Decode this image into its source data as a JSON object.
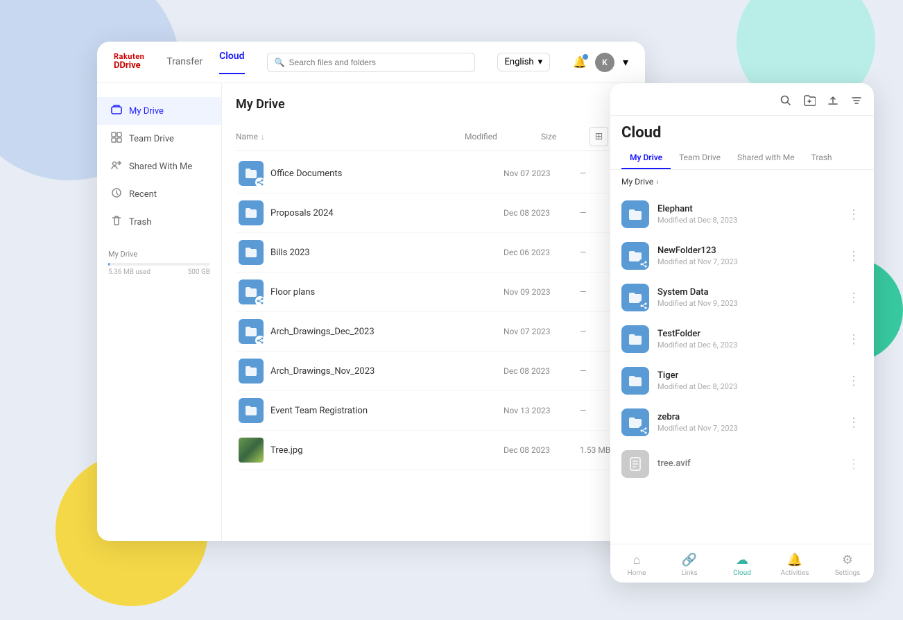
{
  "background": {
    "circles": [
      "blue",
      "teal",
      "yellow",
      "green"
    ]
  },
  "header": {
    "logo_rakuten": "Rakuten",
    "logo_drive": "Drive",
    "nav_transfer": "Transfer",
    "nav_cloud": "Cloud",
    "search_placeholder": "Search files and folders",
    "language": "English",
    "avatar_letter": "K",
    "active_tab": "Cloud"
  },
  "sidebar": {
    "items": [
      {
        "id": "my-drive",
        "label": "My Drive",
        "icon": "🖥",
        "active": true
      },
      {
        "id": "team-drive",
        "label": "Team Drive",
        "icon": "⊞"
      },
      {
        "id": "shared-with-me",
        "label": "Shared With Me",
        "icon": "↗"
      },
      {
        "id": "recent",
        "label": "Recent",
        "icon": "🕐"
      },
      {
        "id": "trash",
        "label": "Trash",
        "icon": "🗑"
      }
    ],
    "storage_label": "My Drive",
    "storage_used": "5.36 MB used",
    "storage_total": "500 GB"
  },
  "file_area": {
    "title": "My Drive",
    "columns": {
      "name": "Name",
      "modified": "Modified",
      "size": "Size"
    },
    "files": [
      {
        "name": "Office Documents",
        "modified": "Nov 07 2023",
        "size": "—",
        "type": "folder-shared"
      },
      {
        "name": "Proposals 2024",
        "modified": "Dec 08 2023",
        "size": "—",
        "type": "folder"
      },
      {
        "name": "Bills 2023",
        "modified": "Dec 06 2023",
        "size": "—",
        "type": "folder"
      },
      {
        "name": "Floor plans",
        "modified": "Nov 09 2023",
        "size": "—",
        "type": "folder-shared"
      },
      {
        "name": "Arch_Drawings_Dec_2023",
        "modified": "Nov 07 2023",
        "size": "—",
        "type": "folder-shared"
      },
      {
        "name": "Arch_Drawings_Nov_2023",
        "modified": "Dec 08 2023",
        "size": "—",
        "type": "folder"
      },
      {
        "name": "Event Team Registration",
        "modified": "Nov 13 2023",
        "size": "—",
        "type": "folder"
      },
      {
        "name": "Tree.jpg",
        "modified": "Dec 08 2023",
        "size": "1.53 MB",
        "type": "image"
      }
    ]
  },
  "right_panel": {
    "title": "Cloud",
    "tabs": [
      "My Drive",
      "Team Drive",
      "Shared with Me",
      "Trash"
    ],
    "active_tab": "My Drive",
    "breadcrumb": "My Drive",
    "files": [
      {
        "name": "Elephant",
        "date": "Modified at Dec 8, 2023",
        "type": "folder"
      },
      {
        "name": "NewFolder123",
        "date": "Modified at Nov 7, 2023",
        "type": "folder-shared"
      },
      {
        "name": "System Data",
        "date": "Modified at Nov 9, 2023",
        "type": "folder-shared"
      },
      {
        "name": "TestFolder",
        "date": "Modified at Dec 6, 2023",
        "type": "folder"
      },
      {
        "name": "Tiger",
        "date": "Modified at Dec 8, 2023",
        "type": "folder"
      },
      {
        "name": "zebra",
        "date": "Modified at Nov 7, 2023",
        "type": "folder-shared"
      },
      {
        "name": "tree.avif",
        "date": "",
        "type": "file"
      }
    ],
    "bottom_nav": [
      {
        "id": "home",
        "label": "Home",
        "icon": "⌂"
      },
      {
        "id": "links",
        "label": "Links",
        "icon": "🔗"
      },
      {
        "id": "cloud",
        "label": "Cloud",
        "icon": "☁",
        "active": true
      },
      {
        "id": "activities",
        "label": "Activities",
        "icon": "🔔"
      },
      {
        "id": "settings",
        "label": "Settings",
        "icon": "⚙"
      }
    ]
  }
}
